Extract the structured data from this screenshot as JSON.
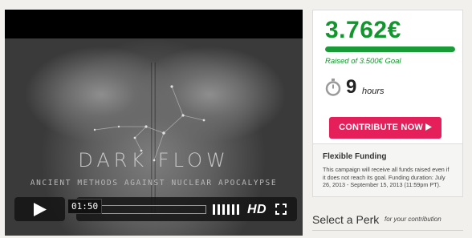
{
  "video": {
    "film_title": "DARK FLOW",
    "film_tagline": "ANCIENT METHODS AGAINST NUCLEAR APOCALYPSE",
    "current_time": "01:50",
    "progress": 0.0,
    "quality_label": "HD",
    "play_icon": "play-icon",
    "volume_icon": "volume-icon",
    "fullscreen_icon": "fullscreen-icon"
  },
  "campaign": {
    "amount_raised": "3.762€",
    "goal_fraction": 1.0,
    "goal_text": "Raised of 3.500€ Goal",
    "time_left_number": "9",
    "time_left_unit": "hours",
    "time_icon": "stopwatch-icon",
    "contribute_label": "CONTRIBUTE NOW",
    "accent_color": "#e41f5a",
    "success_color": "#11962d"
  },
  "funding": {
    "title": "Flexible Funding",
    "description": "This campaign will receive all funds raised even if it does not reach its goal. Funding duration: July 26, 2013 - September 15, 2013 (11:59pm PT)."
  },
  "perks": {
    "title": "Select a Perk",
    "subtitle": "for your contribution"
  }
}
